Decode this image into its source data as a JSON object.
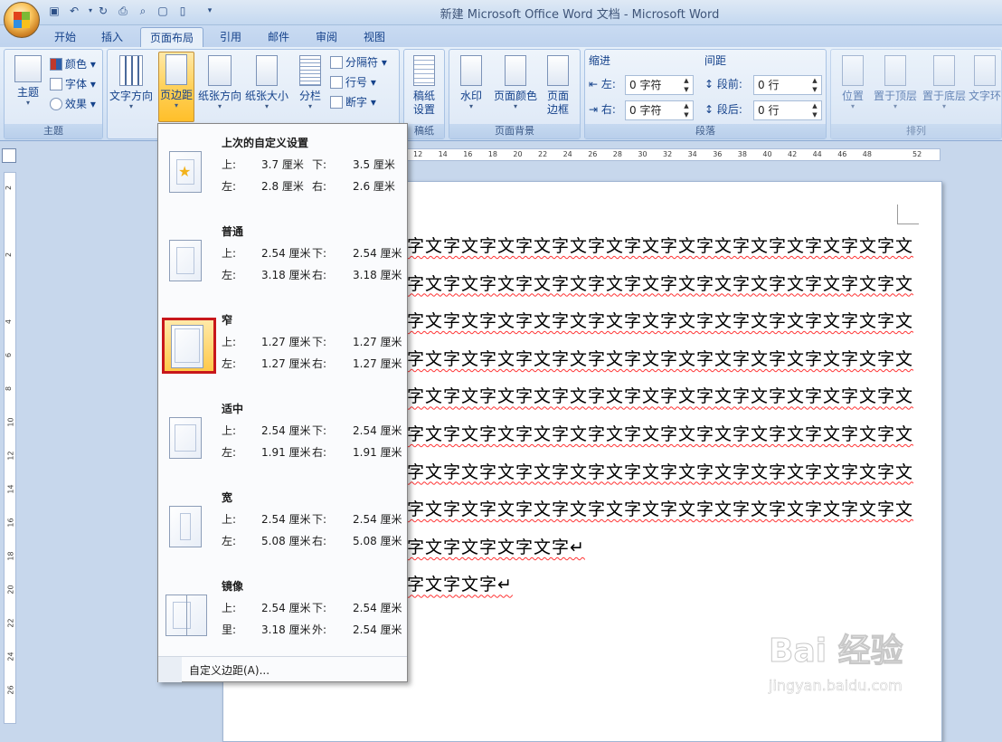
{
  "window": {
    "title": "新建 Microsoft Office Word 文档 - Microsoft Word"
  },
  "tabs": [
    {
      "label": "开始"
    },
    {
      "label": "插入"
    },
    {
      "label": "页面布局"
    },
    {
      "label": "引用"
    },
    {
      "label": "邮件"
    },
    {
      "label": "审阅"
    },
    {
      "label": "视图"
    }
  ],
  "ribbon": {
    "theme_group": {
      "label": "主题",
      "theme_btn": "主题",
      "colors": "颜色",
      "fonts": "字体",
      "effects": "效果"
    },
    "page_setup": {
      "text_direction": "文字方向",
      "margins": "页边距",
      "orientation": "纸张方向",
      "size": "纸张大小",
      "columns": "分栏",
      "breaks": "分隔符",
      "line_numbers": "行号",
      "hyphenation": "断字"
    },
    "draft_group": {
      "label": "稿纸",
      "settings_line1": "稿纸",
      "settings_line2": "设置"
    },
    "page_background": {
      "label": "页面背景",
      "watermark": "水印",
      "page_color": "页面颜色",
      "page_border_line1": "页面",
      "page_border_line2": "边框"
    },
    "paragraph": {
      "label": "段落",
      "indent_title": "缩进",
      "indent_left_label": "左:",
      "indent_left_value": "0 字符",
      "indent_right_label": "右:",
      "indent_right_value": "0 字符",
      "spacing_title": "间距",
      "spacing_before_label": "段前:",
      "spacing_before_value": "0 行",
      "spacing_after_label": "段后:",
      "spacing_after_value": "0 行"
    },
    "arrange": {
      "label": "排列",
      "position": "位置",
      "bring_front": "置于顶层",
      "send_back": "置于底层",
      "wrap": "文字环"
    }
  },
  "ruler": {
    "h_ticks": [
      "12",
      "14",
      "16",
      "18",
      "20",
      "22",
      "24",
      "26",
      "28",
      "30",
      "32",
      "34",
      "36",
      "38",
      "40",
      "42",
      "44",
      "46",
      "48",
      "",
      "52"
    ],
    "v_ticks": [
      "2",
      "",
      "2",
      "",
      "4",
      "6",
      "8",
      "10",
      "12",
      "14",
      "16",
      "18",
      "20",
      "22",
      "24",
      "26"
    ]
  },
  "margins_menu": {
    "presets": [
      {
        "name": "上次的自定义设置",
        "top_label": "上:",
        "top": "3.7 厘米",
        "bottom_label": "下:",
        "bottom": "3.5 厘米",
        "left_label": "左:",
        "left": "2.8 厘米",
        "right_label": "右:",
        "right": "2.6 厘米"
      },
      {
        "name": "普通",
        "top_label": "上:",
        "top": "2.54 厘米",
        "bottom_label": "下:",
        "bottom": "2.54 厘米",
        "left_label": "左:",
        "left": "3.18 厘米",
        "right_label": "右:",
        "right": "3.18 厘米"
      },
      {
        "name": "窄",
        "top_label": "上:",
        "top": "1.27 厘米",
        "bottom_label": "下:",
        "bottom": "1.27 厘米",
        "left_label": "左:",
        "left": "1.27 厘米",
        "right_label": "右:",
        "right": "1.27 厘米"
      },
      {
        "name": "适中",
        "top_label": "上:",
        "top": "2.54 厘米",
        "bottom_label": "下:",
        "bottom": "2.54 厘米",
        "left_label": "左:",
        "left": "1.91 厘米",
        "right_label": "右:",
        "right": "1.91 厘米"
      },
      {
        "name": "宽",
        "top_label": "上:",
        "top": "2.54 厘米",
        "bottom_label": "下:",
        "bottom": "2.54 厘米",
        "left_label": "左:",
        "left": "5.08 厘米",
        "right_label": "右:",
        "right": "5.08 厘米"
      },
      {
        "name": "镜像",
        "top_label": "上:",
        "top": "2.54 厘米",
        "bottom_label": "下:",
        "bottom": "2.54 厘米",
        "left_label": "里:",
        "left": "3.18 厘米",
        "right_label": "外:",
        "right": "2.54 厘米"
      }
    ],
    "custom": "自定义边距(A)..."
  },
  "document": {
    "lines": [
      "字文字文字文字文字文字文字文字文字文字文字文字文字文字文字",
      "字文字文字文字文字文字文字文字文字文字文字文字文字文字文字",
      "字文字文字文字文字文字文字文字文字文字文字文字文字文字文字",
      "字文字文字文字文字文字文字文字文字文字文字文字文字文字文字",
      "字文字文字文字文字文字文字文字文字文字文字文字文字文字文字",
      "字文字文字文字文字文字文字文字文字文字文字文字文字文字文字",
      "字文字文字文字文字文字文字文字文字文字文字文字文字文字文字",
      "字文字文字文字文字文字文字文字文字文字文字文字文字文字文字",
      "字文字文字文字文字↵",
      "字文字文字↵"
    ]
  },
  "watermark": {
    "brand": "Bai 经验",
    "url": "jingyan.baidu.com"
  },
  "colors": {
    "accent": "#15428b",
    "selected_highlight": "#c8171b",
    "active_button": "#ffc94a"
  }
}
